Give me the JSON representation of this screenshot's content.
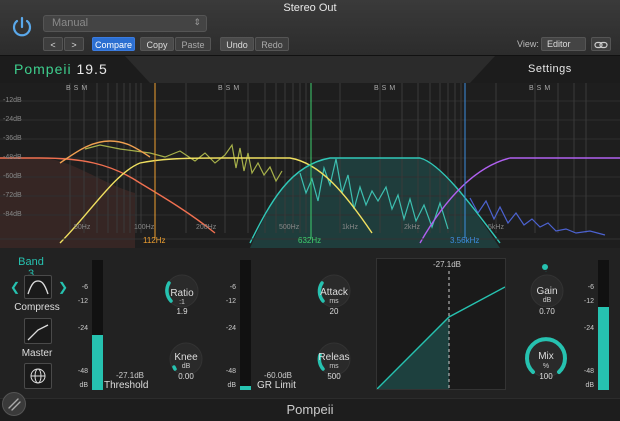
{
  "window": {
    "title": "Stereo Out"
  },
  "toolbar": {
    "preset": "Manual",
    "prev_label": "<",
    "next_label": ">",
    "compare_label": "Compare",
    "copy_label": "Copy",
    "paste_label": "Paste",
    "undo_label": "Undo",
    "redo_label": "Redo",
    "view_label": "View:",
    "view_value": "Editor"
  },
  "plugin": {
    "name": "Pompeii",
    "version": "19.5",
    "settings_label": "Settings",
    "footer_name": "Pompeii"
  },
  "graph": {
    "db_labels": [
      "-12dB",
      "-24dB",
      "-36dB",
      "-48dB",
      "-60dB",
      "-72dB",
      "-84dB"
    ],
    "freq_labels": [
      "50Hz",
      "100Hz",
      "200Hz",
      "500Hz",
      "1kHz",
      "2kHz",
      "5kHz"
    ],
    "band_solo_labels": [
      "BSM",
      "BSM",
      "BSM",
      "BSM"
    ],
    "crossovers": [
      {
        "label": "112Hz",
        "color": "#f0a030"
      },
      {
        "label": "632Hz",
        "color": "#3ecf6e"
      },
      {
        "label": "3.56kHz",
        "color": "#3c8ee0"
      }
    ],
    "band_colors": [
      "#f07050",
      "#f0e060",
      "#30c8b8",
      "#b060f0"
    ]
  },
  "band": {
    "label": "Band 3",
    "compress_label": "Compress",
    "master_label": "Master"
  },
  "threshold": {
    "value": "-27.1dB",
    "label": "Threshold",
    "scale": [
      "-6",
      "-12",
      "-24",
      "-48"
    ],
    "unit": "dB",
    "level": 0.42
  },
  "ratio": {
    "label": "Ratio",
    "unit": ":1",
    "value": "1.9"
  },
  "knee": {
    "label": "Knee",
    "unit": "dB",
    "value": "0.00"
  },
  "gr_limit": {
    "value": "-60.0dB",
    "label": "GR Limit",
    "scale": [
      "-6",
      "-12",
      "-24",
      "-48"
    ],
    "unit": "dB"
  },
  "attack": {
    "label": "Attack",
    "unit": "ms",
    "value": "20"
  },
  "release": {
    "label": "Releas",
    "unit": "ms",
    "value": "500"
  },
  "transfer": {
    "threshold_label": "-27.1dB"
  },
  "gain": {
    "label": "Gain",
    "unit": "dB",
    "value": "0.70"
  },
  "mix": {
    "label": "Mix",
    "unit": "%",
    "value": "100"
  },
  "output_meter": {
    "scale": [
      "-6",
      "-12",
      "-24",
      "-48"
    ],
    "unit": "dB",
    "level": 0.64
  }
}
